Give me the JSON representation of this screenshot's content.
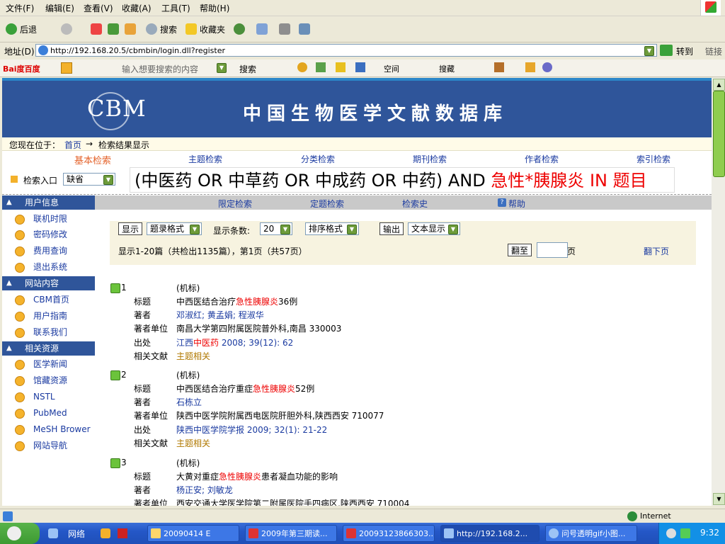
{
  "menu": [
    "文件(F)",
    "编辑(E)",
    "查看(V)",
    "收藏(A)",
    "工具(T)",
    "帮助(H)"
  ],
  "toolbar": {
    "back": "后退",
    "search": "搜索",
    "favorites": "收藏夹"
  },
  "address": {
    "label": "地址(D)",
    "url": "http://192.168.20.5/cbmbin/login.dll?register",
    "go": "转到",
    "links": "链接"
  },
  "baidubar": {
    "logo": "Bai度百度",
    "placeholder": "输入想要搜索的内容",
    "search": "搜索",
    "space": "空间",
    "collect": "搜藏"
  },
  "site": {
    "logo": "CBM",
    "title": "中国生物医学文献数据库",
    "location_label": "您现在位于：",
    "breadcrumb_home": "首页",
    "breadcrumb_arrow": "→",
    "breadcrumb_current": "检索结果显示",
    "tabs": [
      "基本检索",
      "主题检索",
      "分类检索",
      "期刊检索",
      "作者检索",
      "索引检索"
    ],
    "entry_label": "检索入口",
    "entry_value": "缺省",
    "query_prefix": "(中医药 OR 中草药 OR 中成药 OR 中药) AND ",
    "query_term": "急性*胰腺炎 IN 题目",
    "subtabs": [
      "限定检索",
      "定题检索",
      "检索史",
      "帮助"
    ]
  },
  "nav": {
    "user_header": "用户信息",
    "user_items": [
      "联机时限",
      "密码修改",
      "费用查询",
      "退出系统"
    ],
    "site_header": "网站内容",
    "site_items": [
      "CBM首页",
      "用户指南",
      "联系我们"
    ],
    "res_header": "相关资源",
    "res_items": [
      "医学新闻",
      "馆藏资源",
      "NSTL",
      "PubMed",
      "MeSH Brower",
      "网站导航"
    ]
  },
  "controls": {
    "show": "显示",
    "format": "题录格式",
    "count_label": "显示条数:",
    "count": "20",
    "sort": "排序格式",
    "output": "输出",
    "text_display": "文本显示",
    "summary": "显示1-20篇（共检出1135篇），第1页（共57页）",
    "goto": "翻至",
    "page_unit": "页",
    "next": "翻下页"
  },
  "records": [
    {
      "num": "1",
      "type": "(机标)",
      "title_pre": "中西医结合治疗",
      "title_hl": "急性胰腺炎",
      "title_post": "36例",
      "authors": "邓淑红; 黄孟娟; 程淑华",
      "org": "南昌大学第四附属医院普外科,南昌 330003",
      "src_pre": "江西",
      "src_hl": "中医药",
      "src_post": "  2008; 39(12): 62",
      "related": "主题相关"
    },
    {
      "num": "2",
      "type": "(机标)",
      "title_pre": "中西医结合治疗重症",
      "title_hl": "急性胰腺炎",
      "title_post": "52例",
      "authors": "石栋立",
      "org": "陕西中医学院附属西电医院肝胆外科,陕西西安 710077",
      "src_pre": "陕西中医学院学报",
      "src_hl": "",
      "src_post": "  2009; 32(1): 21-22",
      "related": "主题相关"
    },
    {
      "num": "3",
      "type": "(机标)",
      "title_pre": "大黄对重症",
      "title_hl": "急性胰腺炎",
      "title_post": "患者凝血功能的影响",
      "authors": "杨正安; 刘敏龙",
      "org": "西安交通大学医学院第二附属医院手四病区,陕西西安 710004",
      "src_pre": "",
      "src_hl": "",
      "src_post": "",
      "related": ""
    }
  ],
  "labels": {
    "title": "标题",
    "author": "著者",
    "org": "著者单位",
    "source": "出处",
    "related": "相关文献"
  },
  "status": {
    "zone": "Internet"
  },
  "taskbar": {
    "network": "网络",
    "tasks": [
      "20090414 E",
      "2009年第三期读...",
      "20093123866303...",
      "http://192.168.2...",
      "问号透明gif小图..."
    ],
    "clock": "9:32"
  }
}
